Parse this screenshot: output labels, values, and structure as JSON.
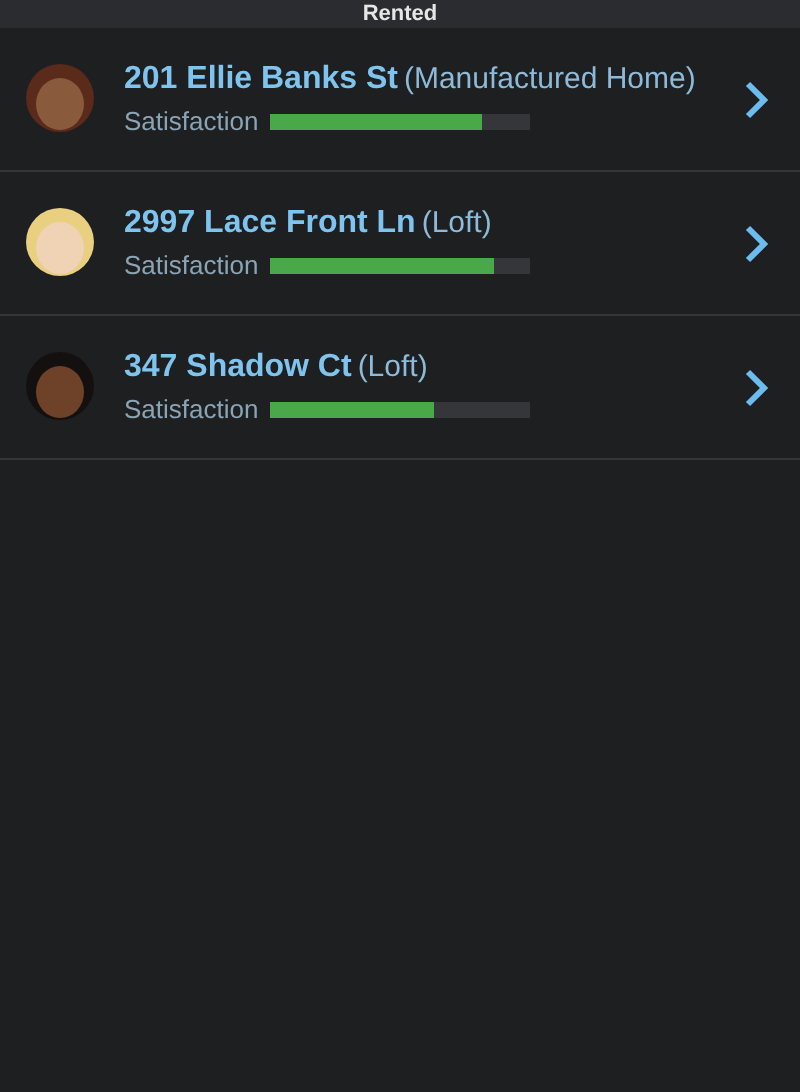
{
  "header": {
    "title": "Rented"
  },
  "rows": [
    {
      "address": "201 Ellie Banks St",
      "type": "(Manufactured Home)",
      "label": "Satisfaction",
      "level": 0.81
    },
    {
      "address": "2997 Lace Front Ln",
      "type": "(Loft)",
      "label": "Satisfaction",
      "level": 0.86
    },
    {
      "address": "347 Shadow Ct",
      "type": "(Loft)",
      "label": "Satisfaction",
      "level": 0.63
    }
  ]
}
